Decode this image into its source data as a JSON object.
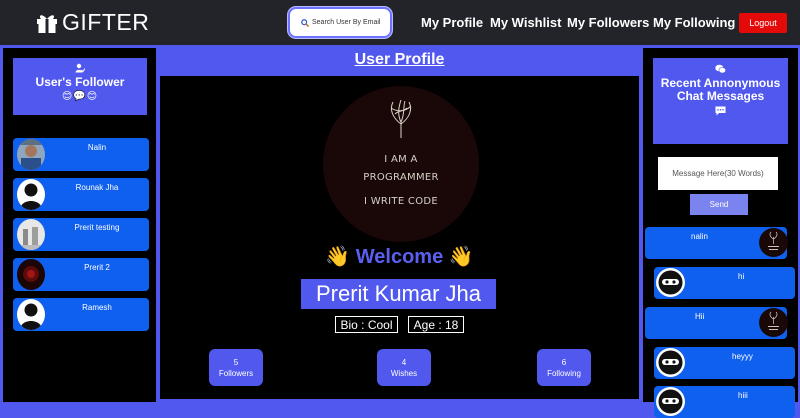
{
  "navbar": {
    "brand": "GIFTER",
    "search_placeholder": "Search User By Email",
    "links": [
      "My Profile",
      "My Wishlist",
      "My Followers",
      "My Following"
    ],
    "logout": "Logout"
  },
  "left_panel": {
    "title": "User's Follower",
    "emoji": "😊💬😊",
    "followers": [
      {
        "name": "Nalin",
        "avatar": "photo"
      },
      {
        "name": "Rounak Jha",
        "avatar": "silhouette"
      },
      {
        "name": "Prerit testing",
        "avatar": "photo-grey"
      },
      {
        "name": "Prerit 2",
        "avatar": "dark-red"
      },
      {
        "name": "Ramesh",
        "avatar": "silhouette"
      }
    ]
  },
  "center": {
    "title": "User Profile",
    "profile_image_text": [
      "I AM A",
      "PROGRAMMER",
      "I WRITE CODE"
    ],
    "welcome": "👋 Welcome 👋",
    "name": "Prerit Kumar Jha",
    "bio": "Bio : Cool",
    "age": "Age : 18",
    "stats": [
      {
        "count": "5",
        "label": "Followers"
      },
      {
        "count": "4",
        "label": "Wishes"
      },
      {
        "count": "6",
        "label": "Following"
      }
    ]
  },
  "right_panel": {
    "title": "Recent Annonymous Chat Messages",
    "input_placeholder": "Message Here(30 Words)",
    "send": "Send",
    "messages": [
      {
        "text": "nalin",
        "side": "left-text"
      },
      {
        "text": "hi",
        "side": "right-text"
      },
      {
        "text": "Hii",
        "side": "left-text"
      },
      {
        "text": "heyyy",
        "side": "right-text"
      },
      {
        "text": "hiii",
        "side": "right-text"
      }
    ]
  },
  "colors": {
    "navbar": "#222429",
    "accent": "#5158ee",
    "item_blue": "#0f60ef",
    "logout_red": "#e50a0a"
  }
}
